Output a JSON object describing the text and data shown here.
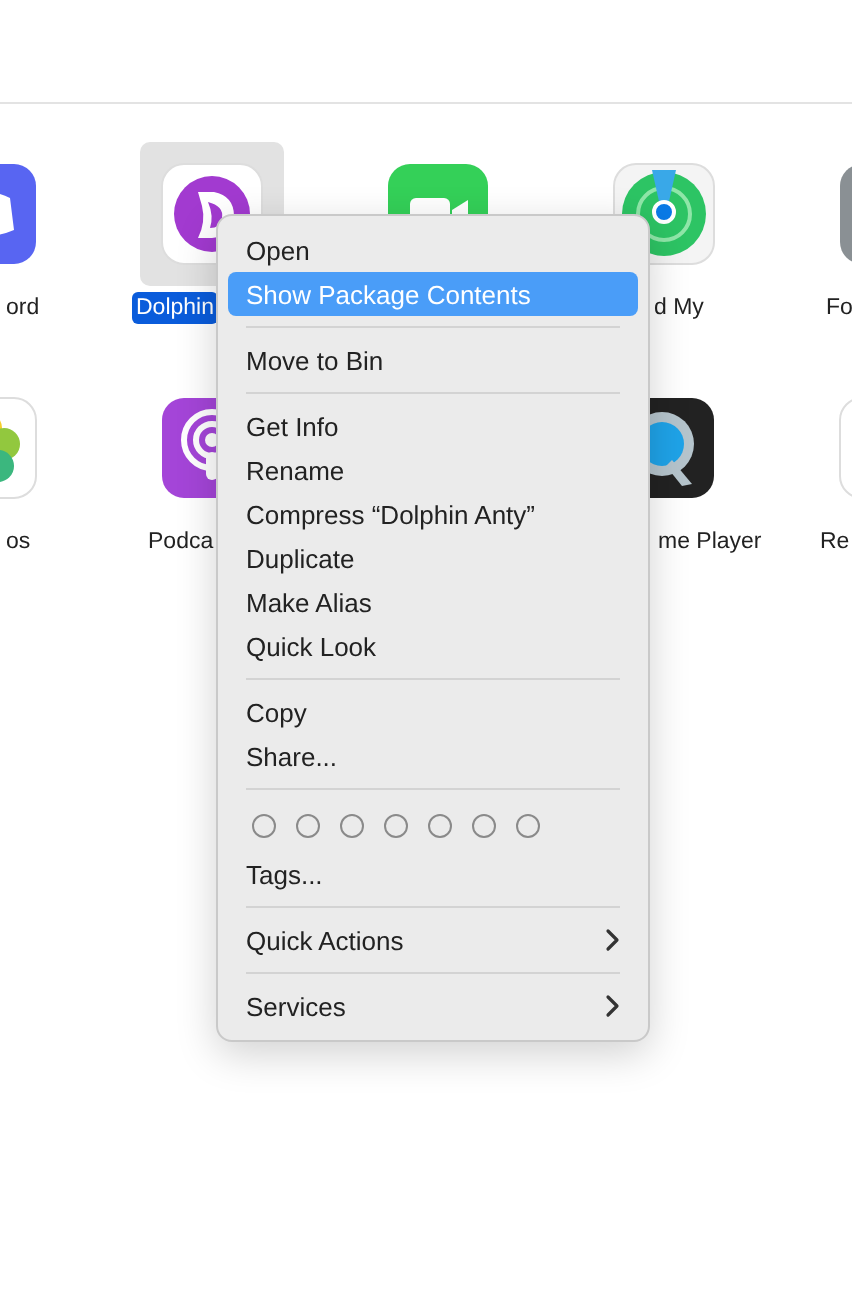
{
  "apps": [
    [
      {
        "label": "ord",
        "kind": "chat",
        "selected": false
      },
      {
        "label": "Dolphin",
        "kind": "dolphin",
        "selected": true
      },
      {
        "kind": "video",
        "selected": false
      },
      {
        "label": "d My",
        "kind": "radar",
        "selected": false
      },
      {
        "label": "Fo",
        "kind": "tile",
        "selected": false
      }
    ],
    [
      {
        "label": "os",
        "kind": "flower",
        "selected": false
      },
      {
        "label": "Podca",
        "kind": "podcast",
        "selected": false
      },
      {
        "label": "me Player",
        "kind": "quicktime",
        "selected": false
      },
      {
        "label": "Re",
        "kind": "list",
        "selected": false
      }
    ]
  ],
  "context_menu": {
    "sections": [
      [
        {
          "label": "Open",
          "selected": false,
          "submenu": false
        },
        {
          "label": "Show Package Contents",
          "selected": true,
          "submenu": false
        }
      ],
      [
        {
          "label": "Move to Bin",
          "selected": false,
          "submenu": false
        }
      ],
      [
        {
          "label": "Get Info",
          "selected": false,
          "submenu": false
        },
        {
          "label": "Rename",
          "selected": false,
          "submenu": false
        },
        {
          "label": "Compress “Dolphin Anty”",
          "selected": false,
          "submenu": false
        },
        {
          "label": "Duplicate",
          "selected": false,
          "submenu": false
        },
        {
          "label": "Make Alias",
          "selected": false,
          "submenu": false
        },
        {
          "label": "Quick Look",
          "selected": false,
          "submenu": false
        }
      ],
      [
        {
          "label": "Copy",
          "selected": false,
          "submenu": false
        },
        {
          "label": "Share...",
          "selected": false,
          "submenu": false
        }
      ],
      [
        {
          "kind": "tags",
          "dots": [
            {
              "selected": false
            },
            {
              "selected": false
            },
            {
              "selected": false
            },
            {
              "selected": false
            },
            {
              "selected": false
            },
            {
              "selected": false
            },
            {
              "selected": false
            }
          ]
        },
        {
          "label": "Tags...",
          "selected": false,
          "submenu": false
        }
      ],
      [
        {
          "label": "Quick Actions",
          "selected": false,
          "submenu": true
        }
      ],
      [
        {
          "label": "Services",
          "selected": false,
          "submenu": true
        }
      ]
    ]
  }
}
